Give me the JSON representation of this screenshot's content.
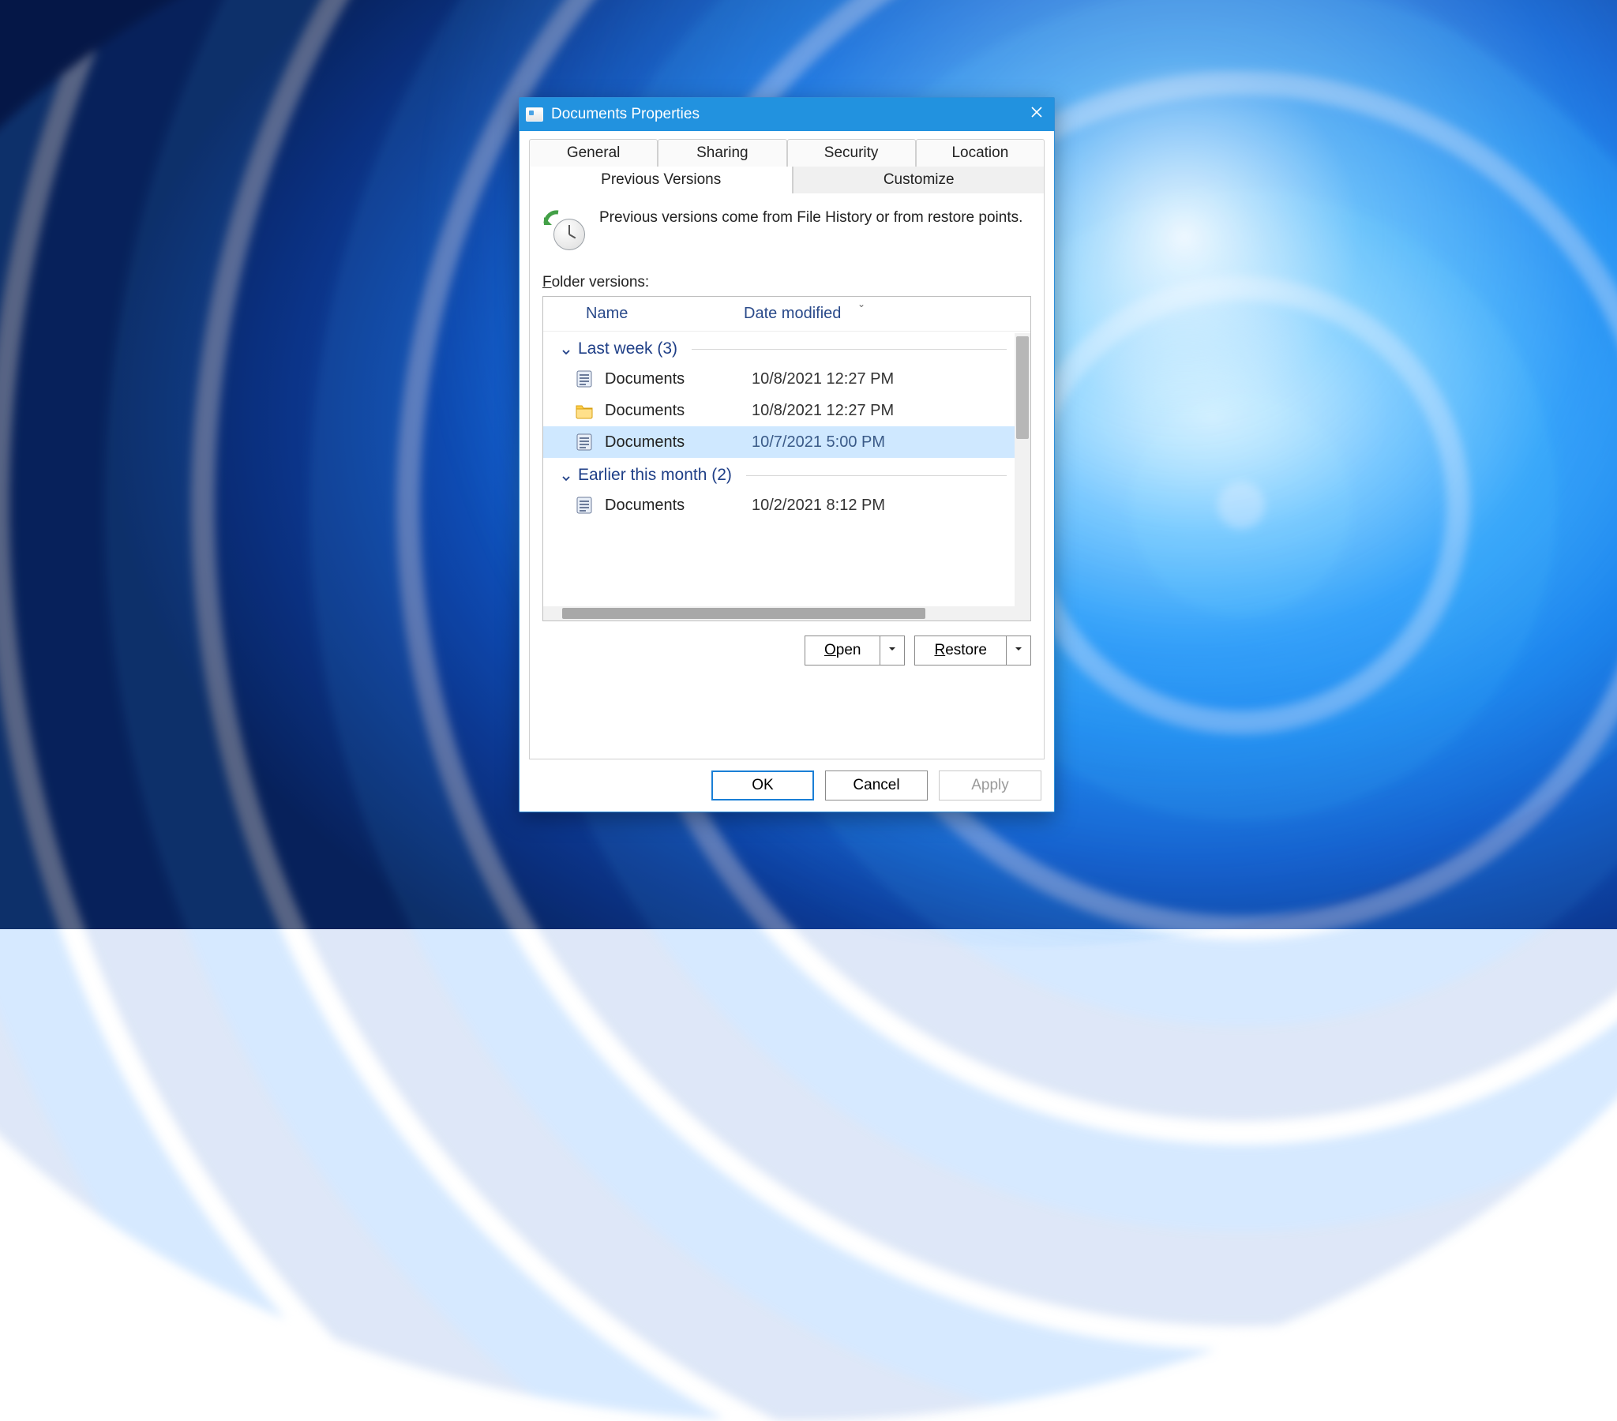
{
  "window": {
    "title": "Documents Properties"
  },
  "tabs": {
    "row1": [
      "General",
      "Sharing",
      "Security",
      "Location"
    ],
    "row2": [
      "Previous Versions",
      "Customize"
    ],
    "active": "Previous Versions"
  },
  "info_text": "Previous versions come from File History or from restore points.",
  "label_folder_versions": "Folder versions:",
  "columns": {
    "name": "Name",
    "date": "Date modified"
  },
  "groups": [
    {
      "title": "Last week (3)",
      "items": [
        {
          "icon": "doc",
          "name": "Documents",
          "date": "10/8/2021 12:27 PM",
          "selected": false
        },
        {
          "icon": "folder",
          "name": "Documents",
          "date": "10/8/2021 12:27 PM",
          "selected": false
        },
        {
          "icon": "doc",
          "name": "Documents",
          "date": "10/7/2021 5:00 PM",
          "selected": true
        }
      ]
    },
    {
      "title": "Earlier this month (2)",
      "items": [
        {
          "icon": "doc",
          "name": "Documents",
          "date": "10/2/2021 8:12 PM",
          "selected": false
        }
      ]
    }
  ],
  "actions": {
    "open": "Open",
    "restore": "Restore"
  },
  "buttons": {
    "ok": "OK",
    "cancel": "Cancel",
    "apply": "Apply"
  }
}
